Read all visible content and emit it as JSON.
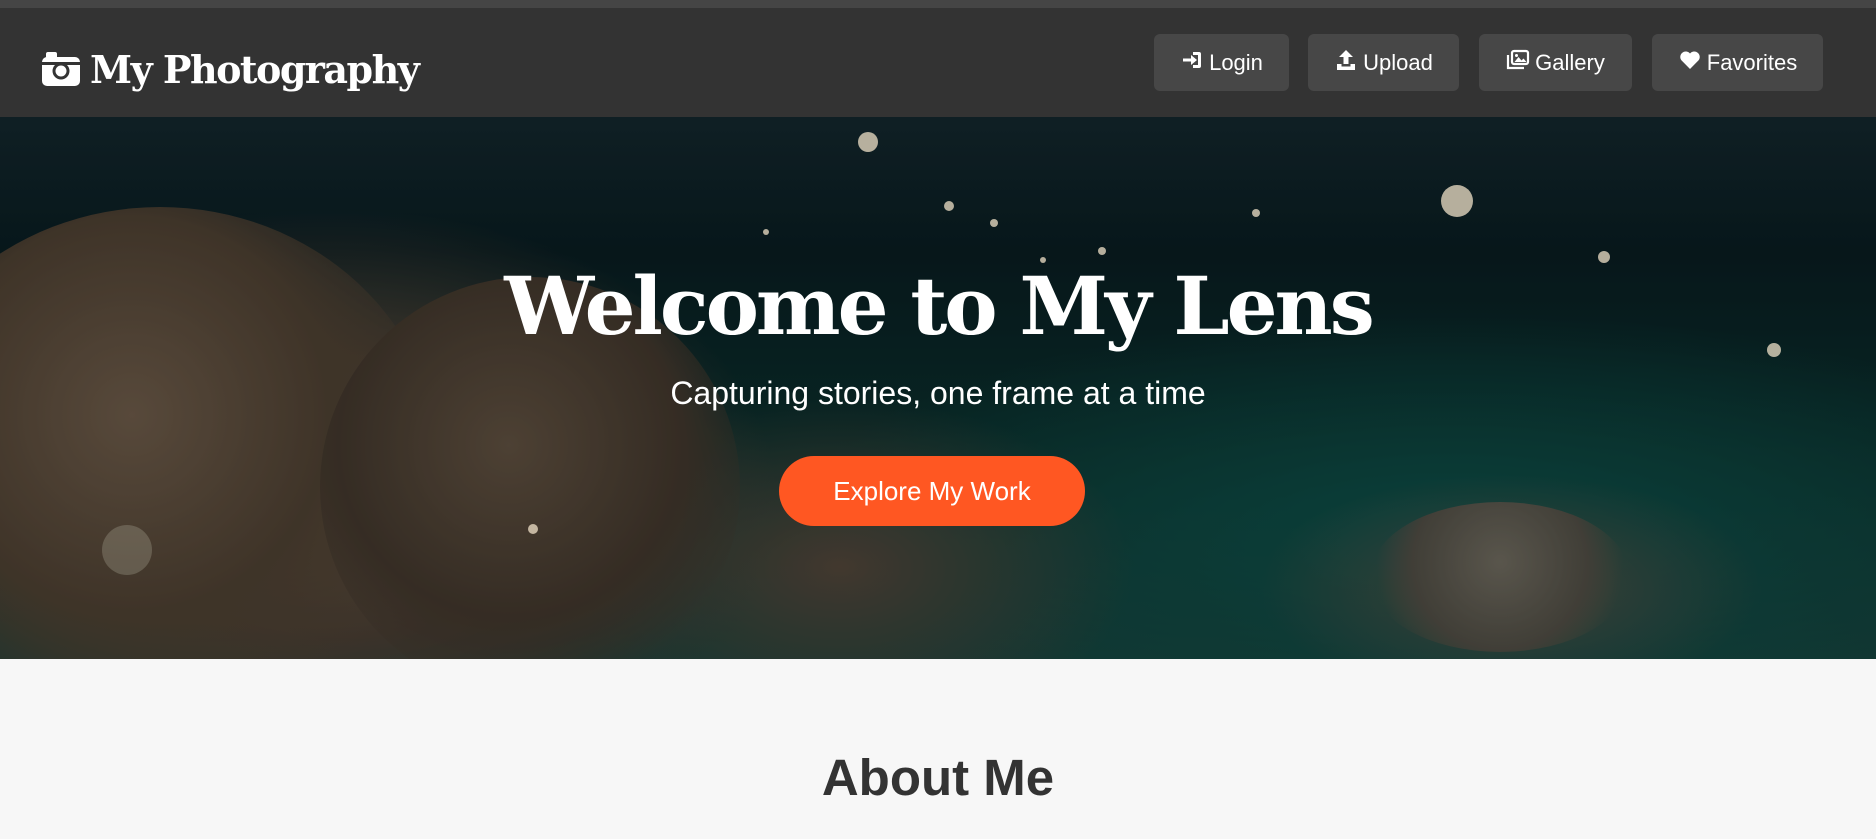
{
  "header": {
    "brand_icon": "camera-icon",
    "brand_title": "My Photography",
    "nav": [
      {
        "label": "Login",
        "icon": "login-icon"
      },
      {
        "label": "Upload",
        "icon": "upload-icon"
      },
      {
        "label": "Gallery",
        "icon": "gallery-icon"
      },
      {
        "label": "Favorites",
        "icon": "heart-icon"
      }
    ]
  },
  "hero": {
    "title": "Welcome to My Lens",
    "subtitle": "Capturing stories, one frame at a time",
    "cta_label": "Explore My Work"
  },
  "about": {
    "title": "About Me"
  },
  "colors": {
    "header_bg": "#333333",
    "nav_button_bg": "#474747",
    "accent": "#ff5722",
    "page_bg": "#f7f7f7"
  }
}
